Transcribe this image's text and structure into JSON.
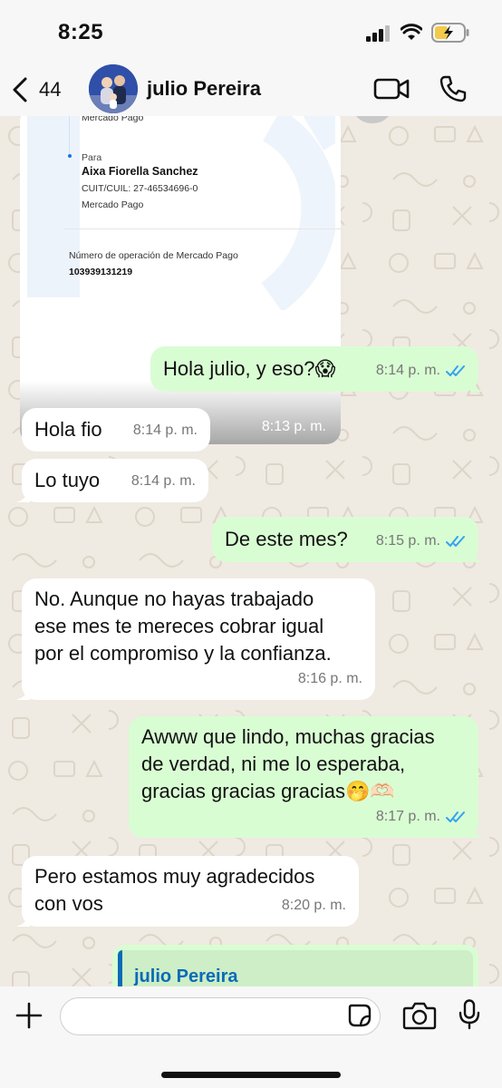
{
  "status_bar": {
    "time": "8:25"
  },
  "header": {
    "back_count": "44",
    "contact_name": "julio Pereira"
  },
  "receipt": {
    "top_line": "Mercado Pago",
    "to_label": "Para",
    "recipient_name": "Aixa Fiorella Sanchez",
    "cuit": "CUIT/CUIL: 27-46534696-0",
    "recipient_bank": "Mercado Pago",
    "operation_label": "Número de operación de Mercado Pago",
    "operation_number": "103939131219",
    "time": "8:13 p. m."
  },
  "messages": [
    {
      "direction": "out",
      "lines": [
        "Hola julio, y eso?😱"
      ],
      "time": "8:14 p. m.",
      "read": true
    },
    {
      "direction": "in",
      "lines": [
        "Hola fio"
      ],
      "time": "8:14 p. m."
    },
    {
      "direction": "in",
      "lines": [
        "Lo tuyo"
      ],
      "time": "8:14 p. m."
    },
    {
      "direction": "out",
      "lines": [
        "De este mes?"
      ],
      "time": "8:15 p. m.",
      "read": true
    },
    {
      "direction": "in",
      "lines": [
        "No. Aunque no hayas trabajado",
        "ese mes te mereces cobrar igual",
        "por el compromiso y la confianza."
      ],
      "time": "8:16 p. m."
    },
    {
      "direction": "out",
      "lines": [
        "Awww que lindo, muchas gracias",
        "de verdad, ni me lo esperaba,",
        "gracias gracias gracias🤭🫶🏻"
      ],
      "time": "8:17 p. m.",
      "read": true
    },
    {
      "direction": "in",
      "lines": [
        "Pero estamos muy agradecidos",
        "con vos"
      ],
      "time": "8:20 p. m."
    }
  ],
  "quoted_reply": {
    "name": "julio Pereira"
  },
  "composer": {
    "placeholder": ""
  },
  "colors": {
    "outgoing": "#d9fdd3",
    "incoming": "#ffffff",
    "read_ticks": "#34a3f0",
    "background": "#efeae2",
    "reply_accent": "#0a6ab8"
  }
}
